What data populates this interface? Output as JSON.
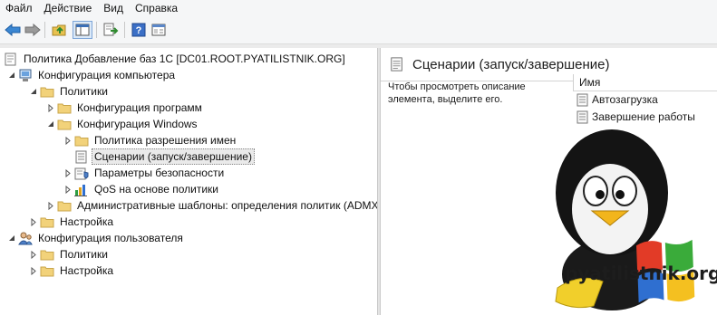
{
  "menu": [
    "Файл",
    "Действие",
    "Вид",
    "Справка"
  ],
  "toolbar": {
    "buttons": [
      "back-icon",
      "forward-icon",
      "up-folder-icon",
      "show-hide-tree-icon",
      "export-list-icon",
      "help-icon",
      "properties-icon"
    ]
  },
  "tree": {
    "root": "Политика Добавление баз 1С [DC01.ROOT.PYATILISTNIK.ORG]",
    "computer_config": "Конфигурация компьютера",
    "policies": "Политики",
    "software_config": "Конфигурация программ",
    "windows_config": "Конфигурация Windows",
    "name_resolution": "Политика разрешения имен",
    "scripts": "Сценарии (запуск/завершение)",
    "security": "Параметры безопасности",
    "qos": "QoS на основе политики",
    "admin_templates": "Административные шаблоны: определения политик (ADMX",
    "preferences": "Настройка",
    "user_config": "Конфигурация пользователя",
    "user_policies": "Политики",
    "user_preferences": "Настройка"
  },
  "right": {
    "title": "Сценарии (запуск/завершение)",
    "description": "Чтобы просмотреть описание элемента, выделите его.",
    "column_name": "Имя",
    "items": [
      "Автозагрузка",
      "Завершение работы"
    ]
  },
  "watermark": "pyatilistnik.org",
  "colors": {
    "folder": "#f2d27a",
    "selection": "#eaeaea",
    "accent": "#3c78c8"
  }
}
